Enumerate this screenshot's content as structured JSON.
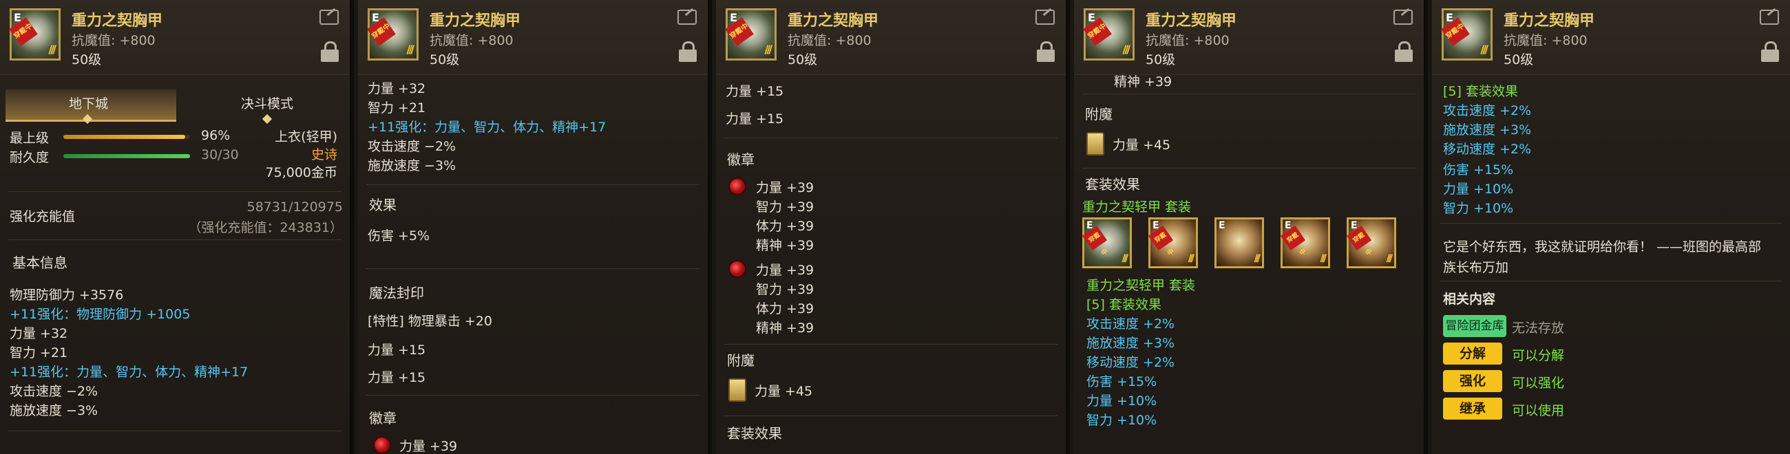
{
  "item": {
    "name": "重力之契胸甲",
    "resist": "抗魔值: +800",
    "level": "50级",
    "grade_badge": "E",
    "stamp_text": "穿戴中"
  },
  "p1": {
    "tab_dungeon": "地下城",
    "tab_duel": "决斗模式",
    "max_level_label": "最上级",
    "max_level_pct": "96%",
    "max_level_value": 0.96,
    "durability_label": "耐久度",
    "durability_value": "30/30",
    "durability_ratio": 1.0,
    "slot": "上衣(轻甲)",
    "rarity": "史诗",
    "price": "75,000金币",
    "enhance_label": "强化充能值",
    "enhance_value": "58731/120975",
    "enhance_sub": "（强化充能值：243831）",
    "basic_info": "基本信息",
    "phys_def": "物理防御力 +3576",
    "plus11_def": "+11强化：物理防御力 +1005",
    "str": "力量 +32",
    "int": "智力 +21",
    "plus11_stats": "+11强化：力量、智力、体力、精神+17",
    "atk_speed": "攻击速度 −2%",
    "cast_speed": "施放速度 −3%"
  },
  "p2": {
    "str": "力量 +32",
    "int": "智力 +21",
    "plus11_stats": "+11强化：力量、智力、体力、精神+17",
    "atk_speed": "攻击速度 −2%",
    "cast_speed": "施放速度 −3%",
    "effect_hdr": "效果",
    "dmg": "伤害 +5%",
    "seal_hdr": "魔法封印",
    "trait": "[特性] 物理暴击 +20",
    "str15a": "力量 +15",
    "str15b": "力量 +15",
    "emblem_hdr": "徽章",
    "partial": "力量 +39"
  },
  "p3": {
    "str15a": "力量 +15",
    "str15b": "力量 +15",
    "emblem_hdr": "徽章",
    "e1": [
      "力量 +39",
      "智力 +39",
      "体力 +39",
      "精神 +39"
    ],
    "e2": [
      "力量 +39",
      "智力 +39",
      "体力 +39",
      "精神 +39"
    ],
    "enchant_hdr": "附魔",
    "enchant": "力量 +45",
    "set_hdr": "套装效果"
  },
  "p4": {
    "spirit_partial": "精神 +39",
    "enchant_hdr": "附魔",
    "enchant": "力量 +45",
    "set_hdr": "套装效果",
    "set_name": "重力之契轻甲 套装",
    "set_name2": "重力之契轻甲 套装",
    "set_bonus": "[5] 套装效果",
    "bonuses": [
      "攻击速度 +2%",
      "施放速度 +3%",
      "移动速度 +2%",
      "伤害 +15%",
      "力量 +10%",
      "智力 +10%"
    ]
  },
  "p5": {
    "set_bonus": "[5] 套装效果",
    "bonuses": [
      "攻击速度 +2%",
      "施放速度 +3%",
      "移动速度 +2%",
      "伤害 +15%",
      "力量 +10%",
      "智力 +10%"
    ],
    "flavor1": "它是个好东西，我这就证明给你看！ ——班图的最高部",
    "flavor2": "族长布万加",
    "related_hdr": "相关内容",
    "bank_btn": "冒险团金库",
    "bank_status": "无法存放",
    "disassemble_btn": "分解",
    "disassemble_status": "可以分解",
    "enhance_btn": "强化",
    "enhance_status": "可以强化",
    "inherit_btn": "继承",
    "inherit_status": "可以使用"
  }
}
